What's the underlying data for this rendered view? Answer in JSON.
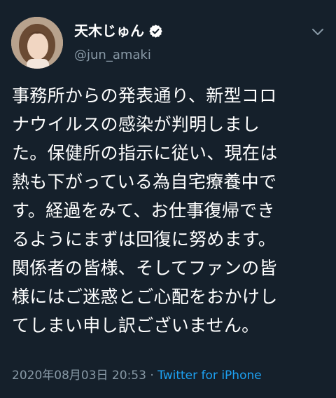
{
  "author": {
    "display_name": "天木じゅん",
    "handle": "@jun_amaki",
    "verified_icon": "verified-badge-icon",
    "avatar_icon": "profile-avatar"
  },
  "menu_icon": "chevron-down-icon",
  "tweet": {
    "lines": [
      "事務所からの発表通り、新型コロ",
      "ナウイルスの感染が判明しまし",
      "た。保健所の指示に従い、現在は",
      "熱も下がっている為自宅療養中で",
      "す。経過をみて、お仕事復帰でき",
      "るようにまずは回復に努めます。",
      "関係者の皆様、そしてファンの皆",
      "様にはご迷惑とご心配をおかけし",
      "てしまい申し訳ございません。"
    ],
    "timestamp": "2020年08月03日 20:53",
    "separator": " · ",
    "source": "Twitter for iPhone"
  },
  "colors": {
    "background": "#15202b",
    "text": "#ffffff",
    "muted": "#8899a6",
    "link": "#1da1f2",
    "verified": "#ffffff"
  }
}
